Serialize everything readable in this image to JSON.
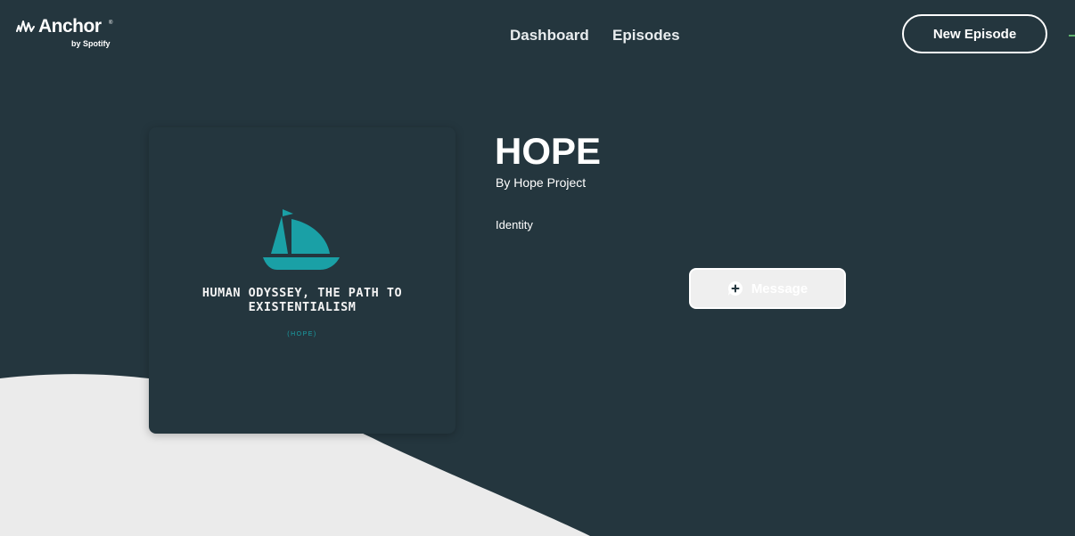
{
  "header": {
    "logo_text": "Anchor",
    "logo_registered": "®",
    "logo_sub": "by Spotify",
    "nav": [
      {
        "label": "Dashboard"
      },
      {
        "label": "Episodes"
      }
    ],
    "new_episode_label": "New Episode"
  },
  "cover": {
    "title": "HUMAN ODYSSEY, THE PATH TO EXISTENTIALISM",
    "subtitle": "(HOPE)",
    "boat_color": "#1aa0a6"
  },
  "podcast": {
    "title": "HOPE",
    "author": "By Hope Project",
    "category": "Identity"
  },
  "actions": {
    "message_label": "Message",
    "message_icon": "chat-plus-icon"
  },
  "colors": {
    "background": "#24363e",
    "wave": "#ebebeb",
    "accent": "#1aa0a6"
  }
}
